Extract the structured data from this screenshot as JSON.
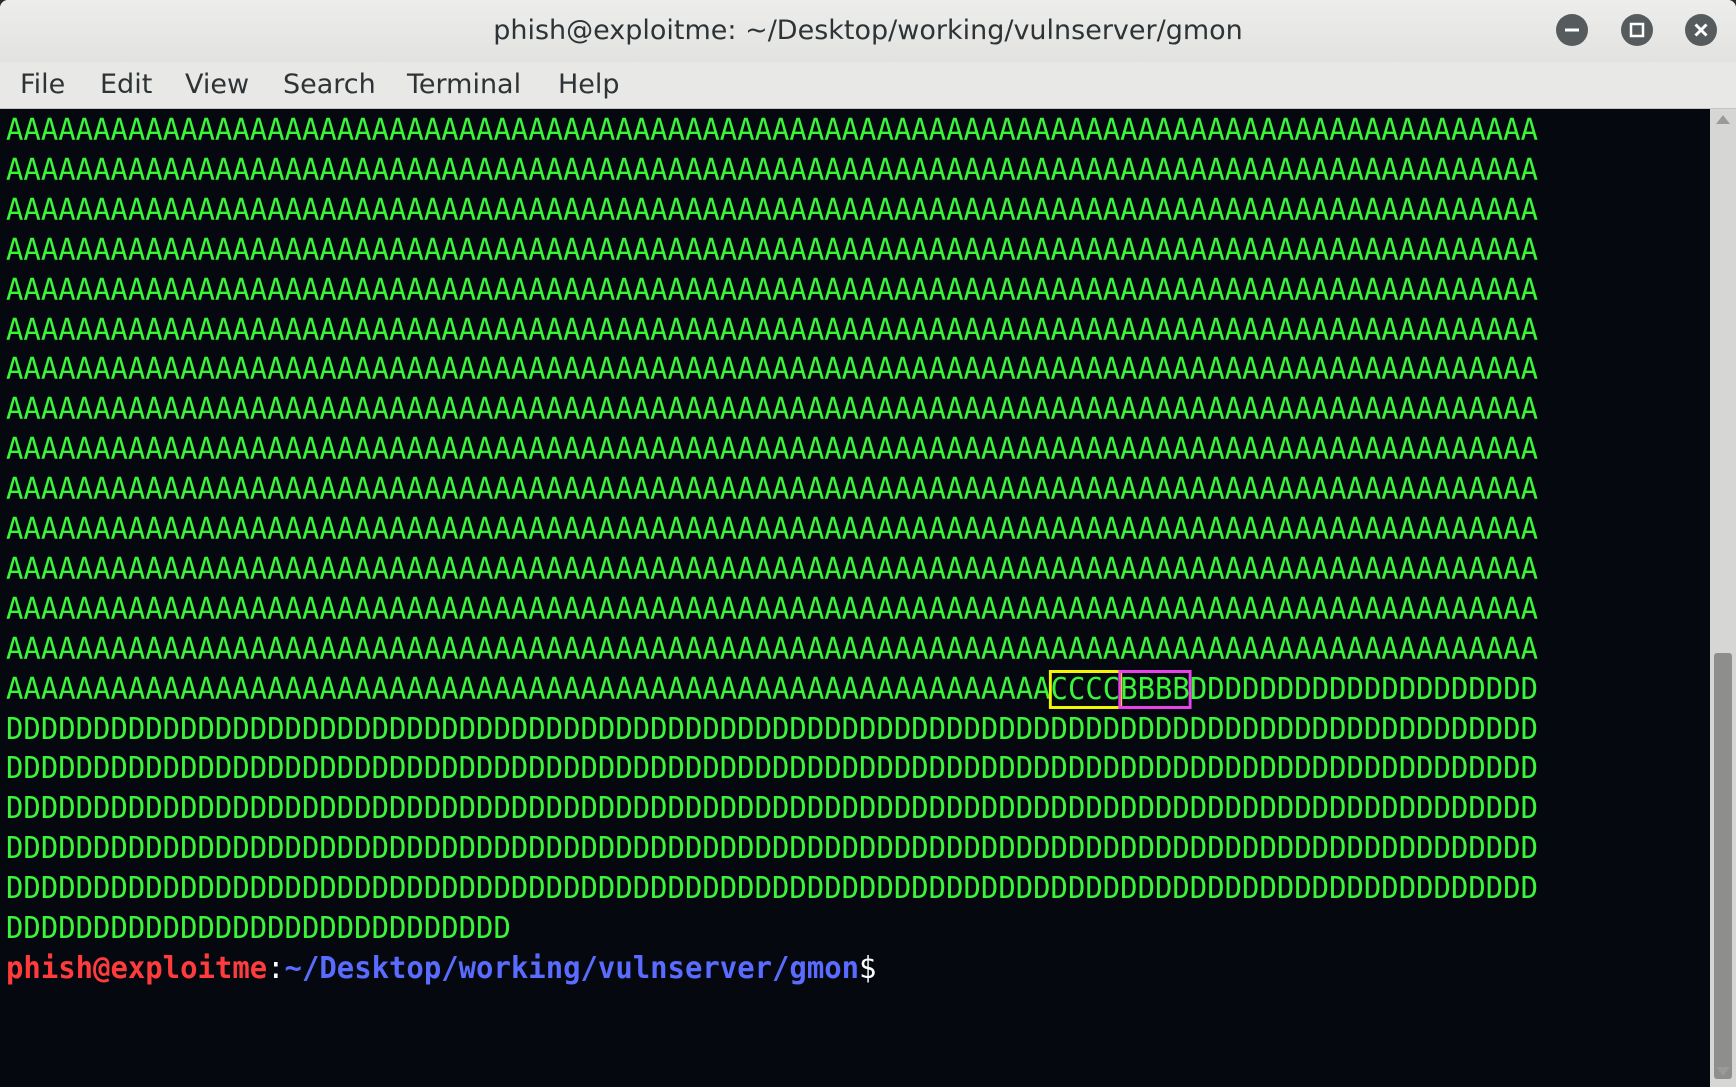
{
  "window": {
    "title": "phish@exploitme: ~/Desktop/working/vulnserver/gmon"
  },
  "menu": [
    "File",
    "Edit",
    "View",
    "Search",
    "Terminal",
    "Help"
  ],
  "terminal": {
    "lines_a": [
      "AAAAAAAAAAAAAAAAAAAAAAAAAAAAAAAAAAAAAAAAAAAAAAAAAAAAAAAAAAAAAAAAAAAAAAAAAAAAAAAAAAAAAAAA",
      "AAAAAAAAAAAAAAAAAAAAAAAAAAAAAAAAAAAAAAAAAAAAAAAAAAAAAAAAAAAAAAAAAAAAAAAAAAAAAAAAAAAAAAAA",
      "AAAAAAAAAAAAAAAAAAAAAAAAAAAAAAAAAAAAAAAAAAAAAAAAAAAAAAAAAAAAAAAAAAAAAAAAAAAAAAAAAAAAAAAA",
      "AAAAAAAAAAAAAAAAAAAAAAAAAAAAAAAAAAAAAAAAAAAAAAAAAAAAAAAAAAAAAAAAAAAAAAAAAAAAAAAAAAAAAAAA",
      "AAAAAAAAAAAAAAAAAAAAAAAAAAAAAAAAAAAAAAAAAAAAAAAAAAAAAAAAAAAAAAAAAAAAAAAAAAAAAAAAAAAAAAAA",
      "AAAAAAAAAAAAAAAAAAAAAAAAAAAAAAAAAAAAAAAAAAAAAAAAAAAAAAAAAAAAAAAAAAAAAAAAAAAAAAAAAAAAAAAA",
      "AAAAAAAAAAAAAAAAAAAAAAAAAAAAAAAAAAAAAAAAAAAAAAAAAAAAAAAAAAAAAAAAAAAAAAAAAAAAAAAAAAAAAAAA",
      "AAAAAAAAAAAAAAAAAAAAAAAAAAAAAAAAAAAAAAAAAAAAAAAAAAAAAAAAAAAAAAAAAAAAAAAAAAAAAAAAAAAAAAAA",
      "AAAAAAAAAAAAAAAAAAAAAAAAAAAAAAAAAAAAAAAAAAAAAAAAAAAAAAAAAAAAAAAAAAAAAAAAAAAAAAAAAAAAAAAA",
      "AAAAAAAAAAAAAAAAAAAAAAAAAAAAAAAAAAAAAAAAAAAAAAAAAAAAAAAAAAAAAAAAAAAAAAAAAAAAAAAAAAAAAAAA",
      "AAAAAAAAAAAAAAAAAAAAAAAAAAAAAAAAAAAAAAAAAAAAAAAAAAAAAAAAAAAAAAAAAAAAAAAAAAAAAAAAAAAAAAAA",
      "AAAAAAAAAAAAAAAAAAAAAAAAAAAAAAAAAAAAAAAAAAAAAAAAAAAAAAAAAAAAAAAAAAAAAAAAAAAAAAAAAAAAAAAA",
      "AAAAAAAAAAAAAAAAAAAAAAAAAAAAAAAAAAAAAAAAAAAAAAAAAAAAAAAAAAAAAAAAAAAAAAAAAAAAAAAAAAAAAAAA",
      "AAAAAAAAAAAAAAAAAAAAAAAAAAAAAAAAAAAAAAAAAAAAAAAAAAAAAAAAAAAAAAAAAAAAAAAAAAAAAAAAAAAAAAAA"
    ],
    "mixed_line": {
      "a_part": "AAAAAAAAAAAAAAAAAAAAAAAAAAAAAAAAAAAAAAAAAAAAAAAAAAAAAAAAAAAA",
      "c_part": "CCCC",
      "b_part": "BBBB",
      "d_part": "DDDDDDDDDDDDDDDDDDDD"
    },
    "lines_d": [
      "DDDDDDDDDDDDDDDDDDDDDDDDDDDDDDDDDDDDDDDDDDDDDDDDDDDDDDDDDDDDDDDDDDDDDDDDDDDDDDDDDDDDDDDD",
      "DDDDDDDDDDDDDDDDDDDDDDDDDDDDDDDDDDDDDDDDDDDDDDDDDDDDDDDDDDDDDDDDDDDDDDDDDDDDDDDDDDDDDDDD",
      "DDDDDDDDDDDDDDDDDDDDDDDDDDDDDDDDDDDDDDDDDDDDDDDDDDDDDDDDDDDDDDDDDDDDDDDDDDDDDDDDDDDDDDDD",
      "DDDDDDDDDDDDDDDDDDDDDDDDDDDDDDDDDDDDDDDDDDDDDDDDDDDDDDDDDDDDDDDDDDDDDDDDDDDDDDDDDDDDDDDD",
      "DDDDDDDDDDDDDDDDDDDDDDDDDDDDDDDDDDDDDDDDDDDDDDDDDDDDDDDDDDDDDDDDDDDDDDDDDDDDDDDDDDDDDDDD",
      "DDDDDDDDDDDDDDDDDDDDDDDDDDDDD"
    ],
    "prompt": {
      "user_host": "phish@exploitme",
      "colon": ":",
      "path": "~/Desktop/working/vulnserver/gmon",
      "symbol": "$"
    }
  },
  "colors": {
    "terminal_bg": "#05080f",
    "output_text": "#3af53a",
    "highlight_c": "#f5f500",
    "highlight_b": "#e843e8",
    "prompt_user": "#ff3b3b",
    "prompt_path": "#5a6cff"
  },
  "icons": {
    "minimize": "minimize-icon",
    "maximize": "maximize-icon",
    "close": "close-icon"
  }
}
